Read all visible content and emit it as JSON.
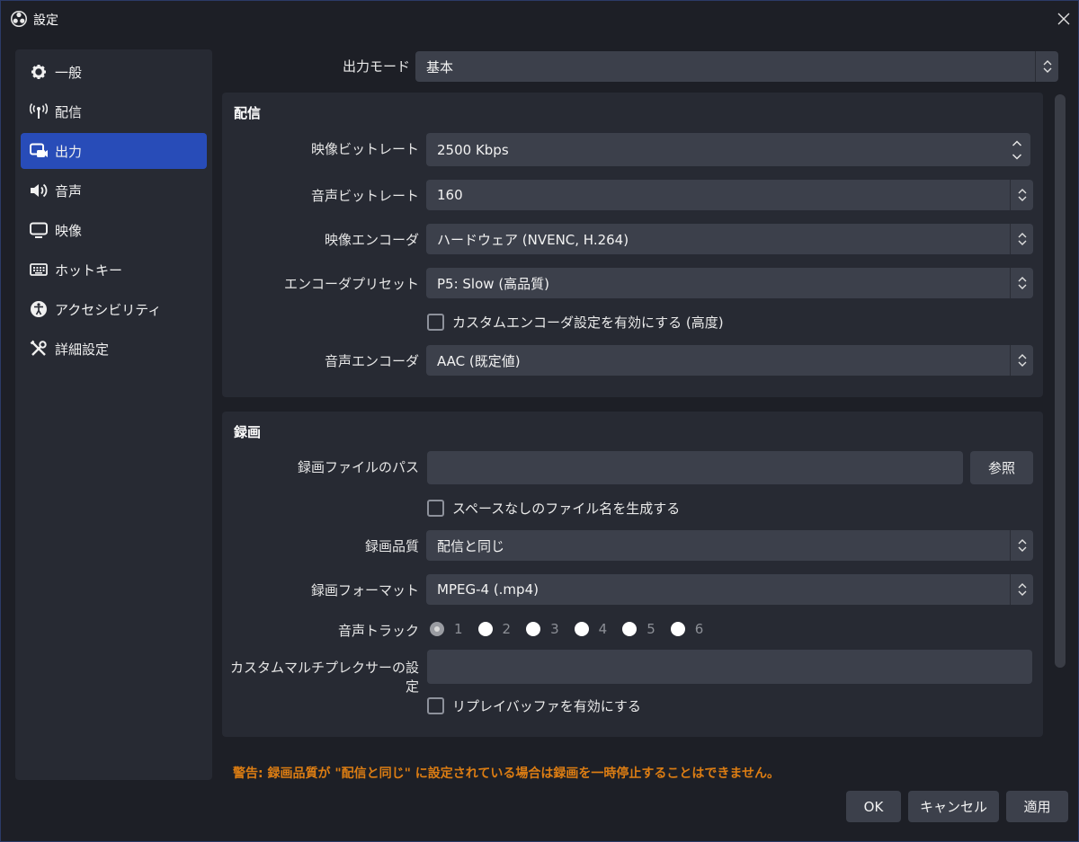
{
  "window": {
    "title": "設定"
  },
  "sidebar": {
    "items": [
      {
        "label": "一般",
        "icon": "gear-icon"
      },
      {
        "label": "配信",
        "icon": "antenna-icon"
      },
      {
        "label": "出力",
        "icon": "output-icon",
        "active": true
      },
      {
        "label": "音声",
        "icon": "speaker-icon"
      },
      {
        "label": "映像",
        "icon": "monitor-icon"
      },
      {
        "label": "ホットキー",
        "icon": "keyboard-icon"
      },
      {
        "label": "アクセシビリティ",
        "icon": "accessibility-icon"
      },
      {
        "label": "詳細設定",
        "icon": "tools-icon"
      }
    ]
  },
  "output_mode": {
    "label": "出力モード",
    "value": "基本"
  },
  "streaming": {
    "title": "配信",
    "video_bitrate": {
      "label": "映像ビットレート",
      "value": "2500 Kbps"
    },
    "audio_bitrate": {
      "label": "音声ビットレート",
      "value": "160"
    },
    "video_encoder": {
      "label": "映像エンコーダ",
      "value": "ハードウェア (NVENC, H.264)"
    },
    "encoder_preset": {
      "label": "エンコーダプリセット",
      "value": "P5: Slow (高品質)"
    },
    "custom_encoder_checkbox": {
      "label": "カスタムエンコーダ設定を有効にする (高度)",
      "checked": false
    },
    "audio_encoder": {
      "label": "音声エンコーダ",
      "value": "AAC (既定値)"
    }
  },
  "recording": {
    "title": "録画",
    "path": {
      "label": "録画ファイルのパス",
      "value": "",
      "browse_label": "参照"
    },
    "no_space_checkbox": {
      "label": "スペースなしのファイル名を生成する",
      "checked": false
    },
    "quality": {
      "label": "録画品質",
      "value": "配信と同じ"
    },
    "format": {
      "label": "録画フォーマット",
      "value": "MPEG-4 (.mp4)"
    },
    "audio_track": {
      "label": "音声トラック",
      "tracks": [
        "1",
        "2",
        "3",
        "4",
        "5",
        "6"
      ],
      "selected": "1"
    },
    "muxer": {
      "label": "カスタムマルチプレクサーの設定",
      "value": ""
    },
    "replay_checkbox": {
      "label": "リプレイバッファを有効にする",
      "checked": false
    }
  },
  "warning": "警告: 録画品質が \"配信と同じ\" に設定されている場合は録画を一時停止することはできません。",
  "footer": {
    "ok": "OK",
    "cancel": "キャンセル",
    "apply": "適用"
  },
  "colors": {
    "accent": "#284cb8",
    "warning": "#dc7d13",
    "panel": "#272a33",
    "field": "#3c404b"
  }
}
